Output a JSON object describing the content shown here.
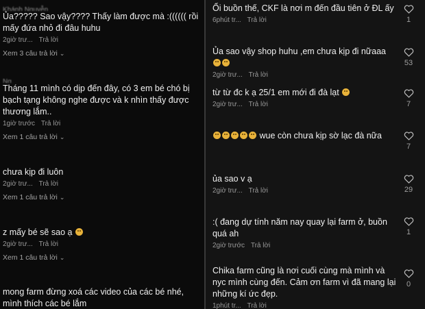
{
  "left": {
    "comments": [
      {
        "user": "Khánh Nguyễn",
        "text": "Ủa????? Sao vậy???? Thấy làm được mà :(((((( rồi mấy đứa nhỏ đi đâu huhu",
        "time": "2giờ trư...",
        "reply": "Trả lời",
        "more": "Xem 3 câu trả lời"
      },
      {
        "user": "Ng...",
        "text": "Tháng 11 mình có dịp đến đây, có 3 em bé chó bị bạch tạng không nghe được và k nhìn thấy được thương lắm..",
        "time": "1giờ trước",
        "reply": "Trả lời",
        "more": "Xem 1 câu trả lời"
      },
      {
        "user": "",
        "text": "chưa kịp đi luôn",
        "time": "2giờ trư...",
        "reply": "Trả lời",
        "more": "Xem 1 câu trả lời"
      },
      {
        "user": "",
        "text": "z mấy bé sẽ sao ạ",
        "time": "2giờ trư...",
        "reply": "Trả lời",
        "more": "Xem 1 câu trả lời"
      },
      {
        "user": "",
        "text": "mong farm đừng xoá các video của các bé nhé, mình thích các bé lắm",
        "time": "",
        "reply": "",
        "more": ""
      }
    ]
  },
  "right": {
    "comments": [
      {
        "user": "",
        "text": "Ối buồn thế, CKF là nơi m đến đầu tiên ở ĐL ấy",
        "time": "6phút tr...",
        "reply": "Trả lời",
        "likes": "1"
      },
      {
        "user": "",
        "text": "Ủa sao vậy shop huhu ,em chưa kịp đi nữaaa",
        "time": "2giờ trư...",
        "reply": "Trả lời",
        "likes": "53"
      },
      {
        "user": "",
        "text": "từ từ đc k ạ 25/1 em mới đi đà lạt",
        "time": "2giờ trư...",
        "reply": "Trả lời",
        "likes": "7"
      },
      {
        "user": "",
        "text": "wue còn chưa kịp sờ lạc đà nữa",
        "time": "",
        "reply": "",
        "likes": "7"
      },
      {
        "user": "",
        "text": "ủa sao v ạ",
        "time": "2giờ trư...",
        "reply": "Trả lời",
        "likes": "29"
      },
      {
        "user": "",
        "text": ":( đang dự tính năm nay quay lại farm ở, buồn quá ah",
        "time": "2giờ trước",
        "reply": "Trả lời",
        "likes": "1"
      },
      {
        "user": "",
        "text": "Chika farm cũng là nơi cuối cùng mà mình và nyc mình cùng đến. Cảm ơn farm vì đã mang lại những kí ức đẹp.",
        "time": "1phút tr...",
        "reply": "Trả lời",
        "likes": "0"
      }
    ]
  },
  "icons": {
    "like": "heart-outline-icon",
    "expand": "chevron-down-icon"
  },
  "colors": {
    "background": "#0b0b0b",
    "text": "#f0f0f0",
    "muted": "#9a9a9a"
  }
}
